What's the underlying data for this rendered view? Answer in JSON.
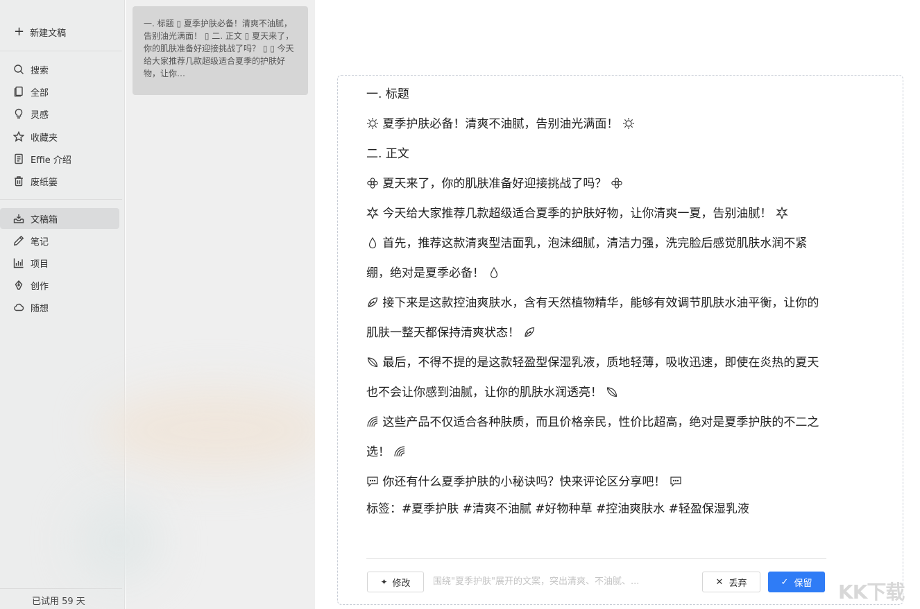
{
  "sidebar": {
    "new_doc": "新建文稿",
    "items": [
      {
        "label": "搜索",
        "icon": "search-icon"
      },
      {
        "label": "全部",
        "icon": "copy-icon"
      },
      {
        "label": "灵感",
        "icon": "lightbulb-icon"
      },
      {
        "label": "收藏夹",
        "icon": "star-icon"
      },
      {
        "label": "Effie 介绍",
        "icon": "document-icon"
      },
      {
        "label": "废纸篓",
        "icon": "trash-icon"
      },
      {
        "label": "文稿箱",
        "icon": "inbox-icon",
        "active": true
      },
      {
        "label": "笔记",
        "icon": "pen-icon"
      },
      {
        "label": "项目",
        "icon": "chart-icon"
      },
      {
        "label": "创作",
        "icon": "nib-icon"
      },
      {
        "label": "随想",
        "icon": "cloud-icon"
      }
    ],
    "trial": "已试用 59 天"
  },
  "card": {
    "preview": "一. 标题 ▯ 夏季护肤必备！清爽不油腻，告别油光满面！ ▯ 二. 正文 ▯ 夏天来了，你的肌肤准备好迎接挑战了吗？ ▯ ▯ 今天给大家推荐几款超级适合夏季的护肤好物，让你…"
  },
  "document": {
    "h1": "一. 标题",
    "title_line": "夏季护肤必备！清爽不油腻，告别油光满面！",
    "h2": "二. 正文",
    "p1": "夏天来了，你的肌肤准备好迎接挑战了吗？",
    "p2": "今天给大家推荐几款超级适合夏季的护肤好物，让你清爽一夏，告别油腻！",
    "p3": "首先，推荐这款清爽型洁面乳，泡沫细腻，清洁力强，洗完脸后感觉肌肤水润不紧绷，绝对是夏季必备！",
    "p4": "接下来是这款控油爽肤水，含有天然植物精华，能够有效调节肌肤水油平衡，让你的肌肤一整天都保持清爽状态！",
    "p5": "最后，不得不提的是这款轻盈型保湿乳液，质地轻薄，吸收迅速，即使在炎热的夏天也不会让你感到油腻，让你的肌肤水润透亮！",
    "p6": "这些产品不仅适合各种肤质，而且价格亲民，性价比超高，绝对是夏季护肤的不二之选！",
    "p7": "你还有什么夏季护肤的小秘诀吗？快来评论区分享吧！",
    "tags": "标签：#夏季护肤 #清爽不油腻 #好物种草 #控油爽肤水 #轻盈保湿乳液"
  },
  "actions": {
    "revise": "修改",
    "hint": "围绕\"夏季护肤\"展开的文案，突出清爽、不油腻、...",
    "discard": "丢弃",
    "keep": "保留"
  },
  "watermark": "KK下载",
  "colors": {
    "accent": "#2f7cf6",
    "sidebar_bg": "#eceded",
    "active_bg": "#dadbdc"
  }
}
